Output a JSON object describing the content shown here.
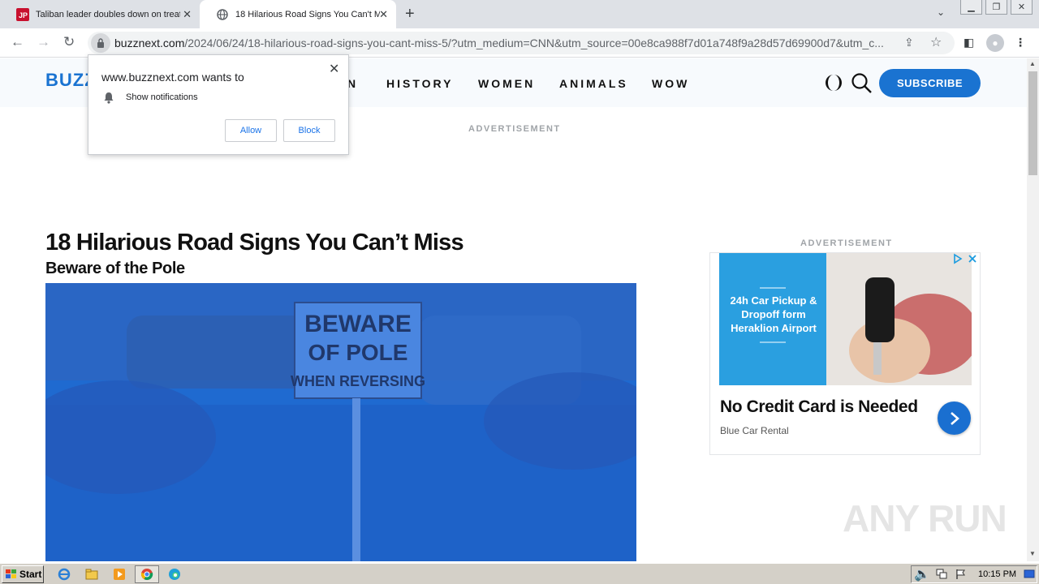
{
  "browser": {
    "tabs": [
      {
        "title": "Taliban leader doubles down on treatment of women",
        "favicon": "JP"
      },
      {
        "title": "18 Hilarious Road Signs You Can't Miss"
      }
    ],
    "url_host": "buzznext.com",
    "url_path": "/2024/06/24/18-hilarious-road-signs-you-cant-miss-5/?utm_medium=CNN&utm_source=00e8ca988f7d01a748f9a28d57d69900d7&utm_c..."
  },
  "site": {
    "logo": "BUZZ",
    "nav": [
      "N",
      "HISTORY",
      "WOMEN",
      "ANIMALS",
      "WOW"
    ],
    "subscribe": "SUBSCRIBE"
  },
  "notification": {
    "title": "www.buzznext.com wants to",
    "text": "Show notifications",
    "allow": "Allow",
    "block": "Block"
  },
  "content": {
    "ad_label_top": "ADVERTISEMENT",
    "ad_label_side": "ADVERTISEMENT",
    "title": "18 Hilarious Road Signs You Can’t Miss",
    "section_heading": "Beware of the Pole",
    "sign_lines": [
      "BEWARE",
      "OF POLE",
      "WHEN REVERSING"
    ]
  },
  "ad": {
    "image_text": "24h Car Pickup & Dropoff form Heraklion Airport",
    "headline": "No Credit Card is Needed",
    "sponsor": "Blue Car Rental"
  },
  "watermark": "ANY RUN",
  "taskbar": {
    "start": "Start",
    "clock": "10:15 PM"
  },
  "colors": {
    "brand": "#1a73d1",
    "overlay": "#1f6fd8"
  }
}
